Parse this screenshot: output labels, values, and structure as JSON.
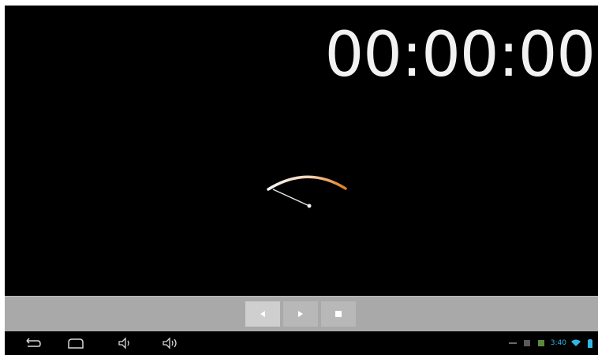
{
  "stopwatch": {
    "elapsed": "00:00:00"
  },
  "controls": {
    "buttons": [
      {
        "name": "rewind-button",
        "icon": "rewind-icon",
        "state": "active"
      },
      {
        "name": "play-button",
        "icon": "play-icon",
        "state": "normal"
      },
      {
        "name": "stop-button",
        "icon": "stop-icon",
        "state": "normal"
      }
    ]
  },
  "navbar": {
    "icons": [
      "back-icon",
      "home-icon",
      "volume-down-icon",
      "volume-up-icon"
    ]
  },
  "status_bar": {
    "icons": [
      "usb-icon",
      "notification-icon",
      "android-icon",
      "wifi-icon",
      "battery-icon"
    ],
    "clock": "3:40"
  },
  "colors": {
    "background": "#000000",
    "control_bar": "#a9a9a9",
    "gauge_arc_start": "#f5f5f5",
    "gauge_arc_end": "#e07a20",
    "status_accent": "#33b5e5"
  }
}
